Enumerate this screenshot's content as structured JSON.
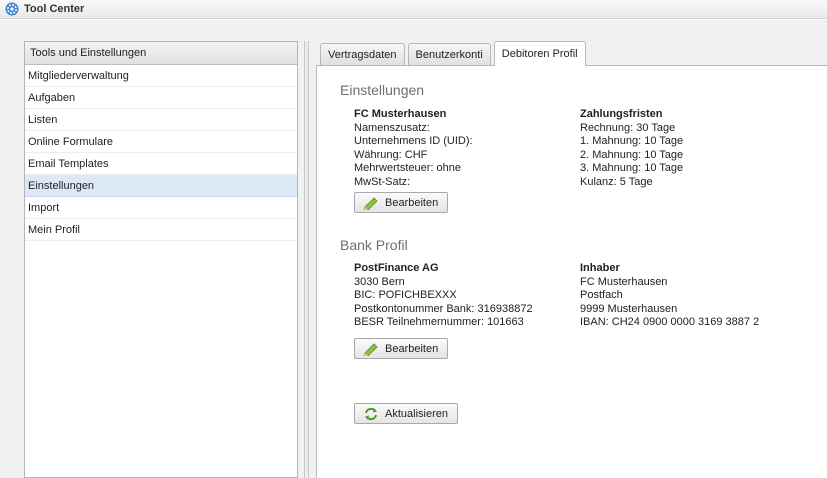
{
  "app": {
    "title": "Tool Center"
  },
  "sidebar": {
    "header": "Tools und Einstellungen",
    "items": [
      {
        "label": "Mitgliederverwaltung"
      },
      {
        "label": "Aufgaben"
      },
      {
        "label": "Listen"
      },
      {
        "label": "Online Formulare"
      },
      {
        "label": "Email Templates"
      },
      {
        "label": "Einstellungen",
        "active": true
      },
      {
        "label": "Import"
      },
      {
        "label": "Mein Profil"
      }
    ]
  },
  "tabs": [
    {
      "label": "Vertragsdaten"
    },
    {
      "label": "Benutzerkonti"
    },
    {
      "label": "Debitoren Profil",
      "active": true
    }
  ],
  "settings": {
    "title": "Einstellungen",
    "club": {
      "name": "FC Musterhausen",
      "lines": [
        "Namenszusatz:",
        "Unternehmens ID (UID):",
        "Währung: CHF",
        "Mehrwertsteuer: ohne",
        "MwSt-Satz:"
      ]
    },
    "payment_terms": {
      "title": "Zahlungsfristen",
      "lines": [
        "Rechnung: 30 Tage",
        "1. Mahnung: 10 Tage",
        "2. Mahnung: 10 Tage",
        "3. Mahnung: 10 Tage",
        "Kulanz: 5 Tage"
      ]
    },
    "edit_label": "Bearbeiten"
  },
  "bank": {
    "title": "Bank Profil",
    "bank": {
      "name": "PostFinance AG",
      "lines": [
        "3030 Bern",
        "BIC: POFICHBEXXX",
        "Postkontonummer Bank: 316938872",
        "BESR Teilnehmernummer: 101663"
      ]
    },
    "owner": {
      "title": "Inhaber",
      "lines": [
        "FC Musterhausen",
        "Postfach",
        "9999 Musterhausen",
        "IBAN: CH24 0900 0000 3169 3887 2"
      ]
    },
    "edit_label": "Bearbeiten"
  },
  "refresh_label": "Aktualisieren",
  "colors": {
    "active_item": "#dce8f6",
    "app_icon": "#3f86cf"
  }
}
